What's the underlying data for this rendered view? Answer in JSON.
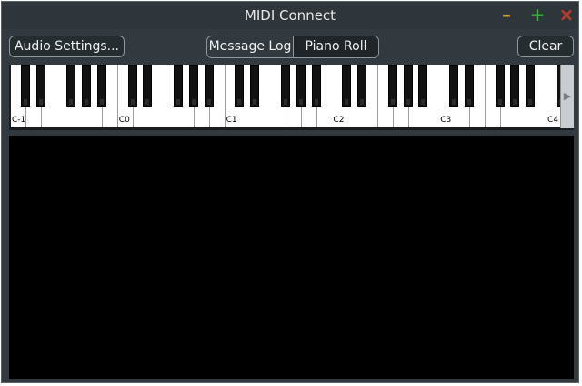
{
  "window": {
    "title": "MIDI Connect",
    "controls": {
      "minimize": "–",
      "maximize": "+",
      "close": "×",
      "minimize_color": "#d4a019",
      "maximize_color": "#2fb82f",
      "close_color": "#c0392b"
    }
  },
  "toolbar": {
    "audio_settings_label": "Audio Settings...",
    "tabs": [
      {
        "label": "Message Log",
        "active": false
      },
      {
        "label": "Piano Roll",
        "active": true
      }
    ],
    "clear_label": "Clear"
  },
  "keyboard": {
    "octave_labels": [
      "C-1",
      "C0",
      "C1",
      "C2",
      "C3",
      "C4"
    ],
    "scroll_right_icon": "▶"
  },
  "colors": {
    "window_bg": "#323a3f",
    "piano_roll_bg": "#000000"
  }
}
